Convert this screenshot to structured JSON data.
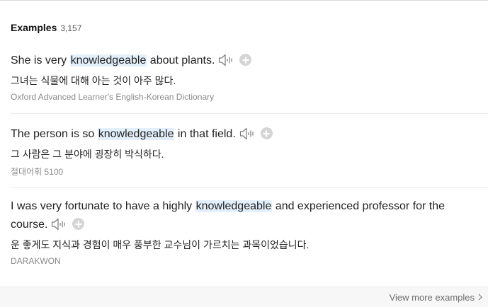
{
  "header": {
    "title": "Examples",
    "count": "3,157"
  },
  "examples": [
    {
      "en_before": "She is very ",
      "highlight": "knowledgeable",
      "en_after": " about plants.",
      "ko": "그녀는 식물에 대해 아는 것이 아주 많다.",
      "source": "Oxford Advanced Learner's English-Korean Dictionary"
    },
    {
      "en_before": "The person is so ",
      "highlight": "knowledgeable",
      "en_after": " in that field.",
      "ko": "그 사람은 그 분야에 굉장히 박식하다.",
      "source": "절대어휘 5100"
    },
    {
      "en_before": "I was very fortunate to have a highly ",
      "highlight": "knowledgeable",
      "en_after": " and experienced professor for the course.",
      "ko": "운 좋게도 지식과 경험이 매우 풍부한 교수님이 가르치는 과목이었습니다.",
      "source": "DARAKWON"
    }
  ],
  "footer": {
    "more_label": "View more examples"
  },
  "icons": {
    "speaker": "speaker-icon",
    "add": "plus-circle-icon",
    "chevron": "chevron-right-icon"
  },
  "colors": {
    "highlight_bg": "#e3f0fb",
    "source_text": "#8a8a8a",
    "footer_bg": "#f7f7f7"
  }
}
